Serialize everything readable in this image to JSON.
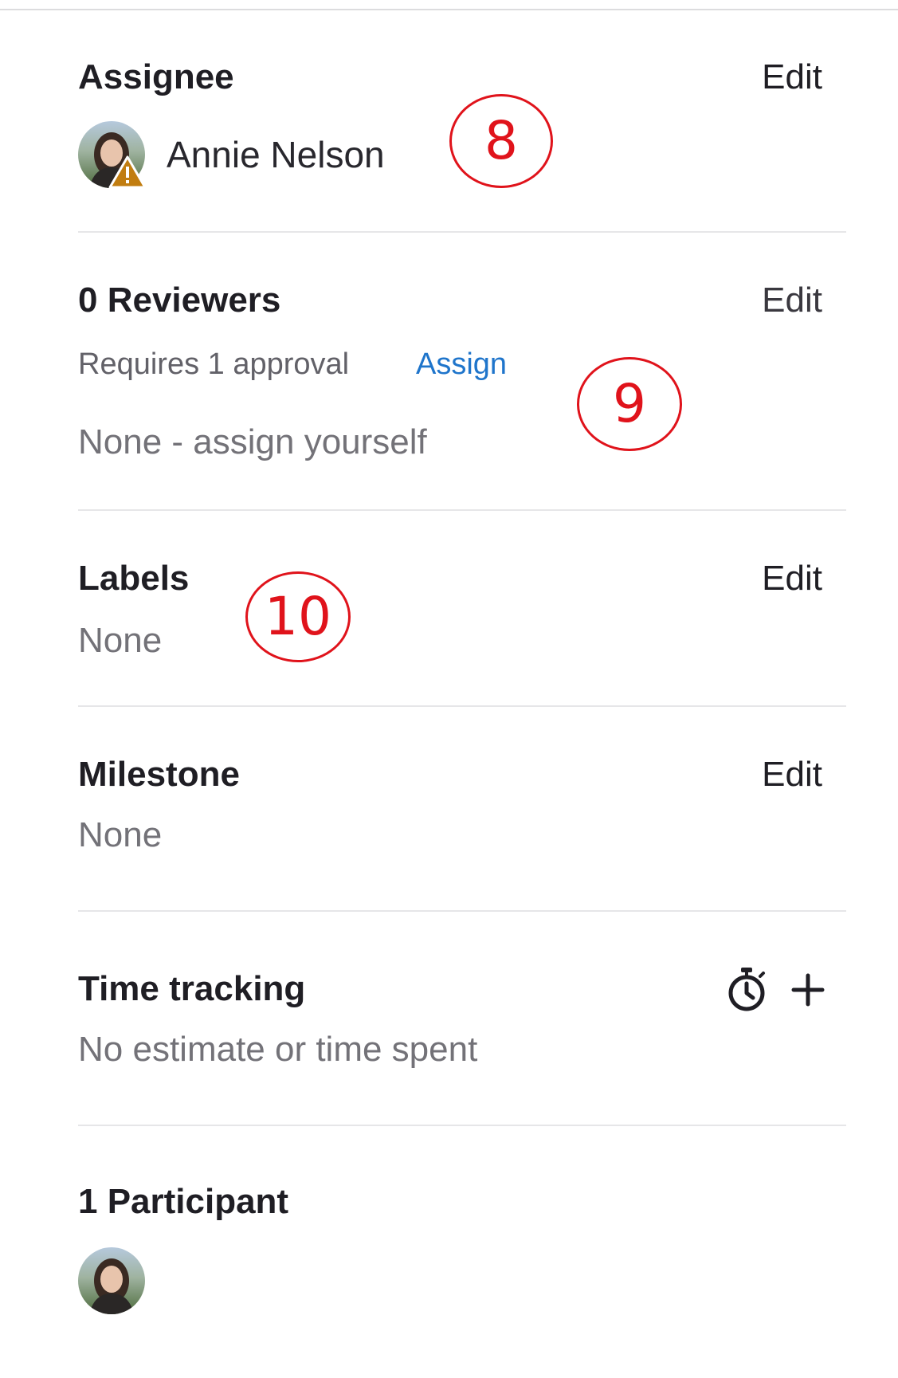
{
  "assignee": {
    "title": "Assignee",
    "edit_label": "Edit",
    "name": "Annie Nelson"
  },
  "reviewers": {
    "title": "0 Reviewers",
    "edit_label": "Edit",
    "requirement": "Requires 1 approval",
    "assign_label": "Assign",
    "empty_text": "None - assign yourself"
  },
  "labels": {
    "title": "Labels",
    "edit_label": "Edit",
    "value": "None"
  },
  "milestone": {
    "title": "Milestone",
    "edit_label": "Edit",
    "value": "None"
  },
  "time_tracking": {
    "title": "Time tracking",
    "value": "No estimate or time spent",
    "icons": [
      "stopwatch-icon",
      "plus-icon"
    ]
  },
  "participants": {
    "title": "1 Participant"
  },
  "annotations": [
    "8",
    "9",
    "10"
  ],
  "colors": {
    "link": "#1f75cb",
    "annotation": "#e0131b",
    "warning": "#c17d10"
  }
}
